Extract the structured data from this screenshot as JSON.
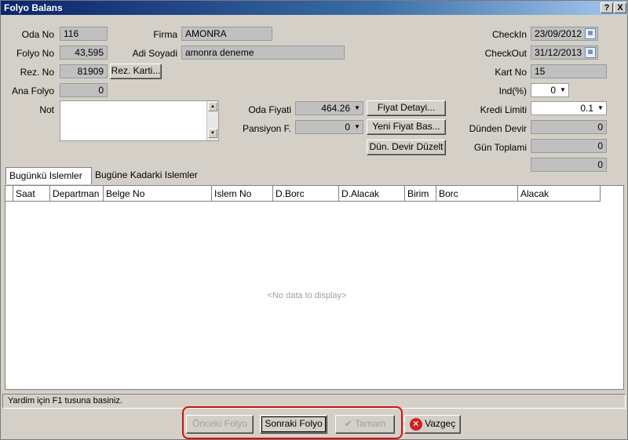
{
  "window": {
    "title": "Folyo Balans",
    "help_glyph": "?",
    "close_glyph": "X"
  },
  "form": {
    "oda_no": {
      "label": "Oda No",
      "value": "116"
    },
    "folyo_no": {
      "label": "Folyo No",
      "value": "43,595"
    },
    "rez_no": {
      "label": "Rez. No",
      "value": "81909"
    },
    "rez_karti_button": "Rez. Karti...",
    "ana_folyo": {
      "label": "Ana Folyo",
      "value": "0"
    },
    "not": {
      "label": "Not",
      "value": ""
    },
    "firma": {
      "label": "Firma",
      "value": "AMONRA"
    },
    "adi_soyadi": {
      "label": "Adi Soyadi",
      "value": "amonra deneme"
    },
    "oda_fiyati": {
      "label": "Oda Fiyati",
      "value": "464.26"
    },
    "pansiyon_f": {
      "label": "Pansiyon F.",
      "value": "0"
    },
    "fiyat_detayi_button": "Fiyat Detayi...",
    "yeni_fiyat_button": "Yeni Fiyat Bas...",
    "dun_devir_button": "Dün. Devir Düzelt",
    "checkin": {
      "label": "CheckIn",
      "value": "23/09/2012"
    },
    "checkout": {
      "label": "CheckOut",
      "value": "31/12/2013"
    },
    "kart_no": {
      "label": "Kart No",
      "value": "15"
    },
    "ind": {
      "label": "Ind(%)",
      "value": "0"
    },
    "kredi_limiti": {
      "label": "Kredi Limiti",
      "value": "0.1"
    },
    "dunden_devir": {
      "label": "Dünden Devir",
      "value": "0"
    },
    "gun_toplami": {
      "label": "Gün Toplami",
      "value": "0"
    },
    "extra_total": {
      "value": "0"
    }
  },
  "tabs": [
    {
      "label": "Bugünkü Islemler",
      "active": true
    },
    {
      "label": "Bugüne Kadarki Islemler",
      "active": false
    }
  ],
  "grid": {
    "columns": [
      "Saat",
      "Departman",
      "Belge No",
      "Islem No",
      "D.Borc",
      "D.Alacak",
      "Birim",
      "Borc",
      "Alacak"
    ],
    "empty_text": "<No data to display>"
  },
  "status_text": "Yardim için F1 tusuna basiniz.",
  "buttons": {
    "onceki": "Önceki Folyo",
    "sonraki": "Sonraki Folyo",
    "tamam": "Tamam",
    "vazgec": "Vazgeç"
  },
  "colors": {
    "highlight": "#d01010",
    "titlebar": "#0a246a"
  }
}
